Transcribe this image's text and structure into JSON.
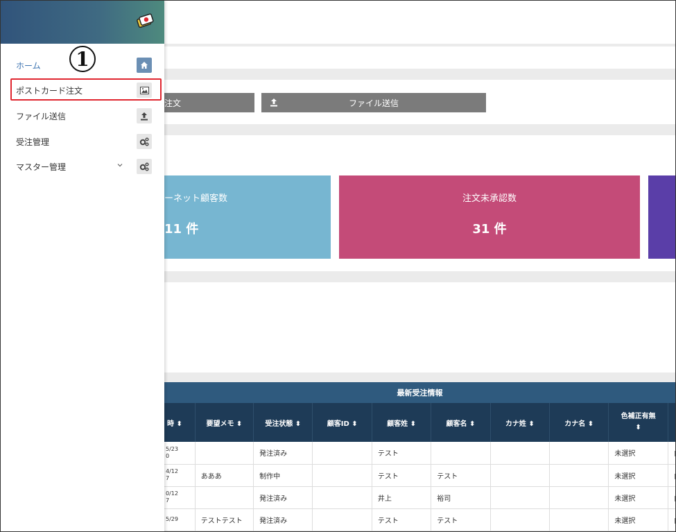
{
  "sidebar": {
    "callout_number": "1",
    "items": [
      {
        "label": "ホーム",
        "icon": "home-icon"
      },
      {
        "label": "ポストカード注文",
        "icon": "image-icon"
      },
      {
        "label": "ファイル送信",
        "icon": "upload-icon"
      },
      {
        "label": "受注管理",
        "icon": "gears-icon"
      },
      {
        "label": "マスター管理",
        "icon": "gears-icon",
        "has_submenu": true
      }
    ]
  },
  "toolbar": {
    "order_button_label": "注文",
    "file_send_button_label": "ファイル送信"
  },
  "stats": [
    {
      "title": "ーネット顧客数",
      "value": "11 件",
      "color": "#77b6d1"
    },
    {
      "title": "注文未承認数",
      "value": "31 件",
      "color": "#c44b78"
    },
    {
      "title": "",
      "value": "",
      "color": "#5a3ea8"
    }
  ],
  "orders": {
    "caption": "最新受注情報",
    "columns": [
      "時 ⬍",
      "要望メモ ⬍",
      "受注状態 ⬍",
      "顧客ID ⬍",
      "顧客姓 ⬍",
      "顧客名 ⬍",
      "カナ姓 ⬍",
      "カナ名 ⬍",
      "色補正有無\n⬍",
      ""
    ],
    "rows": [
      {
        "date1": "5/23",
        "date2": "0",
        "memo": "",
        "status": "発注済み",
        "cust_id": "",
        "last": "テスト",
        "first": "",
        "kana_last": "",
        "kana_first": "",
        "color_fix": "未選択",
        "extra": "白"
      },
      {
        "date1": "4/12",
        "date2": "7",
        "memo": "あああ",
        "status": "制作中",
        "cust_id": "",
        "last": "テスト",
        "first": "テスト",
        "kana_last": "",
        "kana_first": "",
        "color_fix": "未選択",
        "extra": "白"
      },
      {
        "date1": "0/12",
        "date2": "7",
        "memo": "",
        "status": "発注済み",
        "cust_id": "",
        "last": "井上",
        "first": "裕司",
        "kana_last": "",
        "kana_first": "",
        "color_fix": "未選択",
        "extra": "白"
      },
      {
        "date1": "5/29",
        "date2": "",
        "memo": "テストテスト",
        "status": "発注済み",
        "cust_id": "",
        "last": "テスト",
        "first": "テスト",
        "kana_last": "",
        "kana_first": "",
        "color_fix": "未選択",
        "extra": "白"
      }
    ]
  }
}
